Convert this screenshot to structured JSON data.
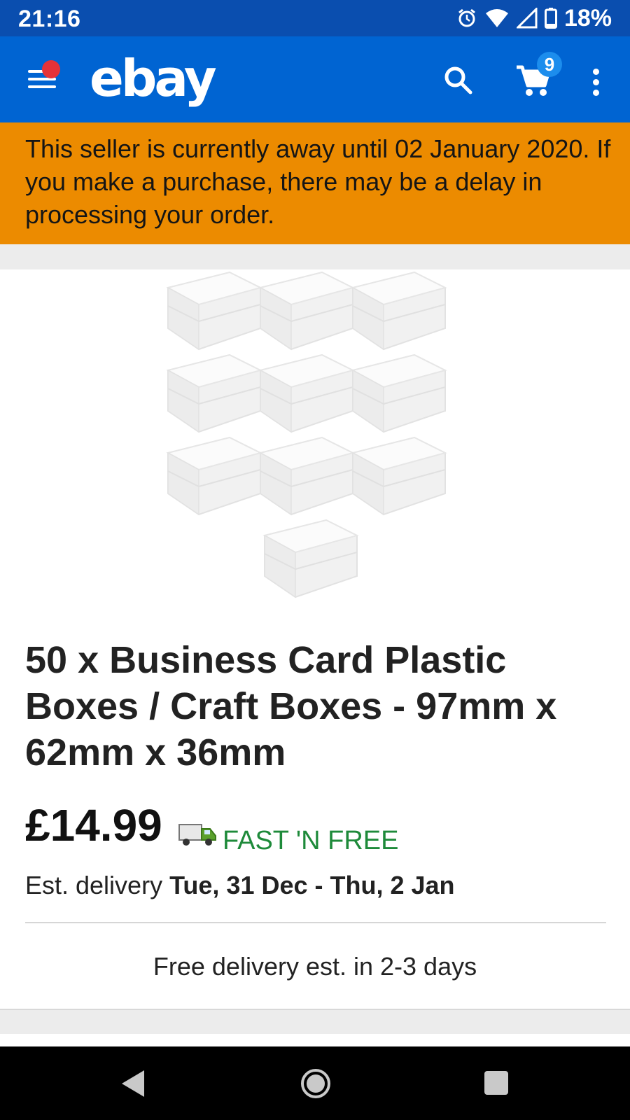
{
  "status_bar": {
    "time": "21:16",
    "battery": "18%",
    "icons": [
      "alarm-icon",
      "wifi-icon",
      "signal-icon",
      "battery-icon"
    ]
  },
  "app_bar": {
    "logo": "ebay",
    "cart_count": "9",
    "icons": [
      "menu-icon",
      "search-icon",
      "cart-icon",
      "more-vert-icon"
    ],
    "color": "#0064d2"
  },
  "away_banner": {
    "text": "This seller is currently away until 02 January 2020. If you make a purchase, there may be a delay in processing your order.",
    "color": "#ec8b00"
  },
  "product": {
    "image_description": "product-image-plastic-boxes",
    "title": "50 x Business Card Plastic Boxes / Craft Boxes - 97mm x 62mm x 36mm",
    "price": "£14.99",
    "shipping_badge": "FAST 'N FREE",
    "est_delivery_label": "Est. delivery",
    "est_delivery_dates": "Tue, 31 Dec - Thu, 2 Jan",
    "free_delivery": "Free delivery est. in 2-3 days"
  },
  "nav_bar": {
    "icons": [
      "back-icon",
      "home-icon",
      "recents-icon"
    ]
  }
}
